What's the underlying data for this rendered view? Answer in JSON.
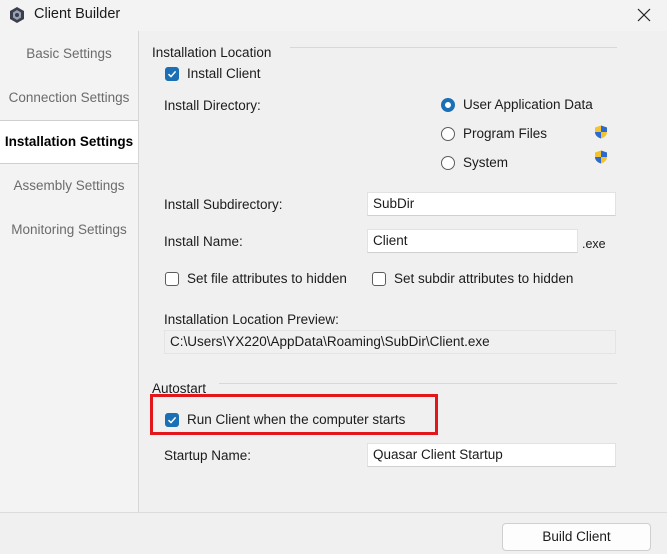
{
  "window": {
    "title": "Client Builder"
  },
  "sidebar": {
    "items": [
      {
        "label": "Basic Settings"
      },
      {
        "label": "Connection Settings"
      },
      {
        "label": "Installation Settings"
      },
      {
        "label": "Assembly Settings"
      },
      {
        "label": "Monitoring Settings"
      }
    ],
    "active_index": 2
  },
  "installation": {
    "group_label": "Installation Location",
    "install_client": {
      "label": "Install Client",
      "checked": true
    },
    "install_directory_label": "Install Directory:",
    "directory_options": [
      {
        "label": "User Application Data",
        "selected": true,
        "admin_icon": false
      },
      {
        "label": "Program Files",
        "selected": false,
        "admin_icon": true
      },
      {
        "label": "System",
        "selected": false,
        "admin_icon": true
      }
    ],
    "subdirectory": {
      "label": "Install Subdirectory:",
      "value": "SubDir"
    },
    "install_name": {
      "label": "Install Name:",
      "value": "Client",
      "suffix": ".exe"
    },
    "hide_file": {
      "label": "Set file attributes to hidden",
      "checked": false
    },
    "hide_subdir": {
      "label": "Set subdir attributes to hidden",
      "checked": false
    },
    "preview": {
      "label": "Installation Location Preview:",
      "value": "C:\\Users\\YX220\\AppData\\Roaming\\SubDir\\Client.exe"
    }
  },
  "autostart": {
    "group_label": "Autostart",
    "run_on_startup": {
      "label": "Run Client when the computer starts",
      "checked": true
    },
    "startup_name": {
      "label": "Startup Name:",
      "value": "Quasar Client Startup"
    }
  },
  "footer": {
    "build_label": "Build Client"
  },
  "colors": {
    "accent": "#1a6fb5",
    "highlight": "#e3161b"
  }
}
